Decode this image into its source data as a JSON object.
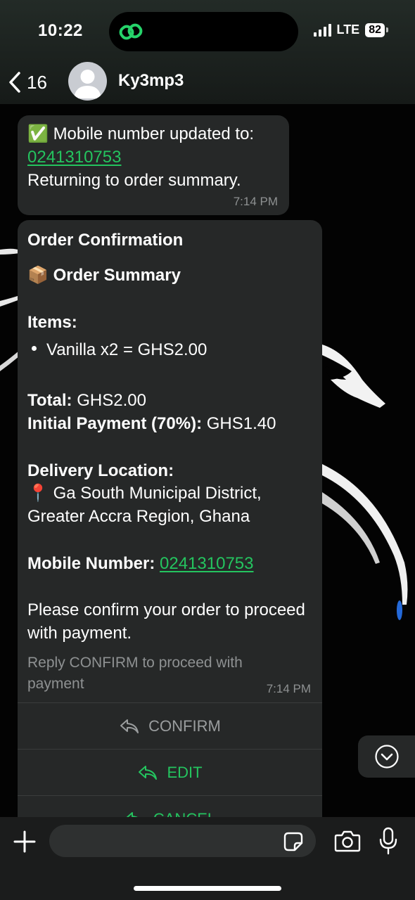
{
  "status_bar": {
    "time": "10:22",
    "network": "LTE",
    "battery": "82"
  },
  "header": {
    "back_count": "16",
    "contact_name": "Ky3mp3"
  },
  "messages": [
    {
      "check_emoji": "✅",
      "line1": "Mobile number updated to:",
      "phone": "0241310753",
      "line3": "Returning to order summary.",
      "time": "7:14 PM"
    },
    {
      "title": "Order Confirmation",
      "summary_emoji": "📦",
      "summary_label": "Order Summary",
      "items_label": "Items:",
      "items": [
        "Vanilla x2 = GHS2.00"
      ],
      "total_label": "Total:",
      "total_value": "GHS2.00",
      "initial_label": "Initial Payment (70%):",
      "initial_value": "GHS1.40",
      "delivery_label": "Delivery Location:",
      "pin_emoji": "📍",
      "delivery_value": "Ga South Municipal District, Greater Accra Region, Ghana",
      "mobile_label": "Mobile Number:",
      "mobile_value": "0241310753",
      "confirm_message": "Please confirm your order to proceed with payment.",
      "footer": "Reply CONFIRM to proceed with payment",
      "time": "7:14 PM",
      "buttons": [
        "CONFIRM",
        "EDIT",
        "CANCEL"
      ]
    }
  ],
  "input": {
    "placeholder": ""
  },
  "colors": {
    "accent": "#24c45f",
    "bubble": "#262828",
    "timestamp": "#8e9192"
  },
  "icons": [
    "back-chevron-icon",
    "avatar-person-icon",
    "reply-arrow-icon",
    "chevron-down-icon",
    "plus-icon",
    "sticker-icon",
    "camera-icon",
    "mic-icon"
  ]
}
